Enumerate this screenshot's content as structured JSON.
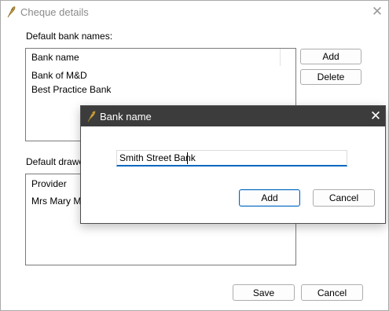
{
  "window": {
    "title": "Cheque details",
    "icon": "quill-pen-icon"
  },
  "bank_names": {
    "label": "Default bank names:",
    "column_header": "Bank name",
    "rows": [
      "Bank of M&D",
      "Best Practice Bank"
    ],
    "add_label": "Add",
    "delete_label": "Delete"
  },
  "drawers": {
    "label": "Default drawers",
    "column_header": "Provider",
    "rows": [
      "Mrs Mary Mar"
    ]
  },
  "footer": {
    "save_label": "Save",
    "cancel_label": "Cancel"
  },
  "dialog": {
    "title": "Bank name",
    "icon": "quill-pen-icon",
    "input_value": "Smith Street Bank",
    "add_label": "Add",
    "cancel_label": "Cancel"
  },
  "colors": {
    "dialog_titlebar": "#3c3c3c",
    "accent": "#0067c0"
  }
}
